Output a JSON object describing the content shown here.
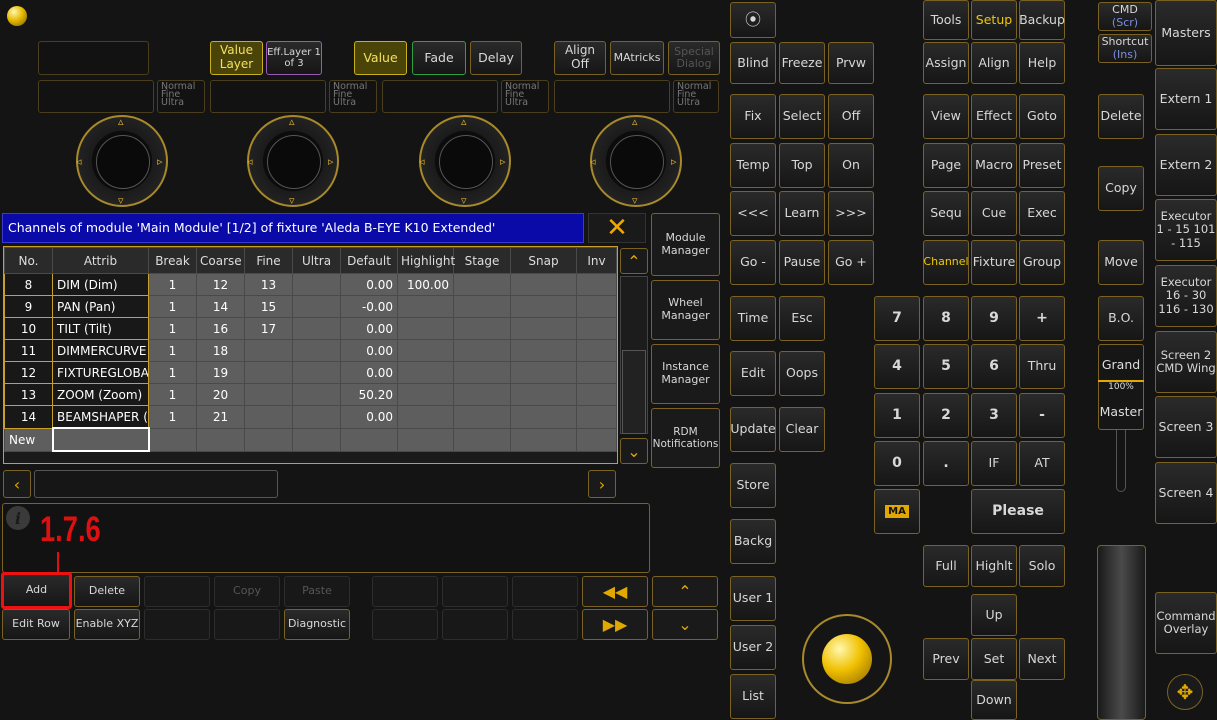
{
  "encoder_bar": {
    "value_layer": "Value Layer",
    "eff_layer": "Eff.Layer 1 of 3",
    "value": "Value",
    "fade": "Fade",
    "delay": "Delay",
    "align_off": "Align Off",
    "matricks": "MAtricks",
    "special_dialog": "Special Dialog",
    "resolution": "Normal Fine Ultra"
  },
  "dialog": {
    "title": "Channels of module 'Main Module' [1/2] of fixture 'Aleda B-EYE K10 Extended'",
    "columns": [
      "No.",
      "Attrib",
      "Break",
      "Coarse",
      "Fine",
      "Ultra",
      "Default",
      "Highlight",
      "Stage",
      "Snap",
      "Inv"
    ],
    "rows": [
      {
        "no": "8",
        "attrib": "DIM (Dim)",
        "break": "1",
        "coarse": "12",
        "fine": "13",
        "ultra": "",
        "default": "0.00",
        "highlight": "100.00"
      },
      {
        "no": "9",
        "attrib": "PAN (Pan)",
        "break": "1",
        "coarse": "14",
        "fine": "15",
        "ultra": "",
        "default": "-0.00",
        "highlight": ""
      },
      {
        "no": "10",
        "attrib": "TILT (Tilt)",
        "break": "1",
        "coarse": "16",
        "fine": "17",
        "ultra": "",
        "default": "0.00",
        "highlight": ""
      },
      {
        "no": "11",
        "attrib": "DIMMERCURVE (",
        "break": "1",
        "coarse": "18",
        "fine": "",
        "ultra": "",
        "default": "0.00",
        "highlight": ""
      },
      {
        "no": "12",
        "attrib": "FIXTUREGLOBAL",
        "break": "1",
        "coarse": "19",
        "fine": "",
        "ultra": "",
        "default": "0.00",
        "highlight": ""
      },
      {
        "no": "13",
        "attrib": "ZOOM (Zoom)",
        "break": "1",
        "coarse": "20",
        "fine": "",
        "ultra": "",
        "default": "50.20",
        "highlight": ""
      },
      {
        "no": "14",
        "attrib": "BEAMSHAPER (B",
        "break": "1",
        "coarse": "21",
        "fine": "",
        "ultra": "",
        "default": "0.00",
        "highlight": ""
      }
    ],
    "new_row_label": "New",
    "side": {
      "module_manager": "Module Manager",
      "wheel_manager": "Wheel Manager",
      "instance_manager": "Instance Manager",
      "rdm_notifications": "RDM Notifications"
    },
    "annotation": "1.7.6",
    "buttons": {
      "add": "Add",
      "delete": "Delete",
      "copy": "Copy",
      "paste": "Paste",
      "edit_row": "Edit Row",
      "enable_xyz": "Enable XYZ",
      "diagnostic": "Diagnostic"
    }
  },
  "console": {
    "col1": {
      "blind": "Blind",
      "fix": "Fix",
      "temp": "Temp",
      "prev_page": "<<<",
      "go_minus": "Go -",
      "time": "Time",
      "edit": "Edit",
      "update": "Update",
      "store": "Store",
      "backg": "Backg",
      "user1": "User 1",
      "user2": "User 2",
      "list": "List"
    },
    "col2": {
      "freeze": "Freeze",
      "select": "Select",
      "top": "Top",
      "learn": "Learn",
      "pause": "Pause",
      "esc": "Esc",
      "oops": "Oops",
      "clear": "Clear"
    },
    "col3": {
      "prvw": "Prvw",
      "off": "Off",
      "on": "On",
      "next_page": ">>>",
      "go_plus": "Go +"
    },
    "right": {
      "tools": "Tools",
      "setup": "Setup",
      "backup": "Backup",
      "assign": "Assign",
      "align": "Align",
      "help": "Help",
      "view": "View",
      "effect": "Effect",
      "goto": "Goto",
      "page": "Page",
      "macro": "Macro",
      "preset": "Preset",
      "sequ": "Sequ",
      "cue": "Cue",
      "exec": "Exec",
      "channel": "Channel",
      "fixture": "Fixture",
      "group": "Group"
    },
    "keypad": {
      "k7": "7",
      "k8": "8",
      "k9": "9",
      "plus": "+",
      "k4": "4",
      "k5": "5",
      "k6": "6",
      "thru": "Thru",
      "k1": "1",
      "k2": "2",
      "k3": "3",
      "minus": "-",
      "k0": "0",
      "dot": ".",
      "if": "IF",
      "at": "AT",
      "please": "Please",
      "full": "Full",
      "highlt": "Highlt",
      "solo": "Solo",
      "up": "Up",
      "prev": "Prev",
      "set": "Set",
      "next": "Next",
      "down": "Down",
      "ma_logo": "MA"
    },
    "far_right": {
      "cmd": "CMD",
      "cmd_sub": "(Scr)",
      "shortcut": "Shortcut",
      "shortcut_sub": "(Ins)",
      "delete": "Delete",
      "copy": "Copy",
      "move": "Move",
      "bo": "B.O.",
      "grand": "Grand",
      "grand_pct": "100%",
      "master": "Master"
    },
    "masters": {
      "masters": "Masters",
      "extern1": "Extern 1",
      "extern2": "Extern 2",
      "executor1": "Executor 1 - 15 101 - 115",
      "executor2": "Executor 16 - 30 116 - 130",
      "screen2": "Screen 2 CMD Wing",
      "screen3": "Screen 3",
      "screen4": "Screen 4",
      "command_overlay": "Command Overlay"
    }
  },
  "colors": {
    "accent": "#c8a030",
    "title_bar": "#0a0aa8",
    "annotation": "#e01010"
  }
}
